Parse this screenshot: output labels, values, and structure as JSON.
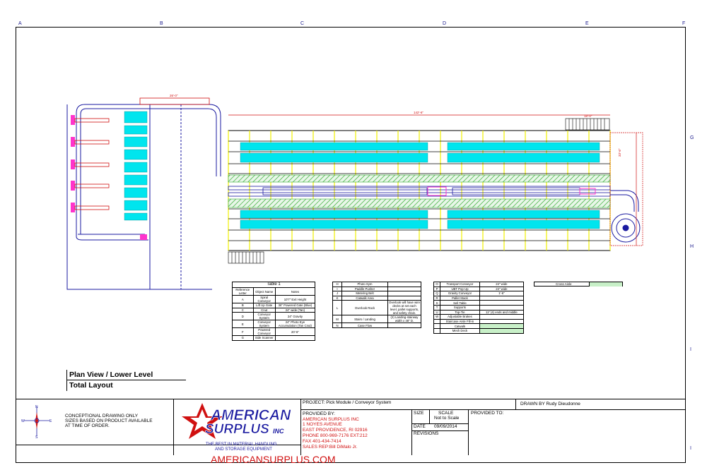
{
  "grid": {
    "top_letters": [
      "A",
      "B",
      "C",
      "D",
      "E",
      "F"
    ],
    "right_letters": [
      "G",
      "H",
      "I",
      "I"
    ]
  },
  "colors": {
    "conveyor_cyan": "#00e5ee",
    "rail_pink": "#ff33cc",
    "dim_red": "#d01010",
    "outline_blue": "#1a1aa0",
    "hatch_green": "#33aa33",
    "post_yellow": "#f0f000"
  },
  "drawing": {
    "dims": {
      "top_width": "26'-0\"",
      "long_width": "142'-6\"",
      "right_box": "18'-0\"",
      "side": "33'-6\""
    }
  },
  "table1": {
    "title": "Table 1",
    "headers": [
      "Reference Letter",
      "Object Name",
      "Notes"
    ],
    "rows": [
      [
        "A",
        "Spiral Conveyor",
        "10'7\" Exit Height"
      ],
      [
        "B",
        "Lift Up Gate",
        "36\" Powered Gate (Blue)"
      ],
      [
        "C",
        "Cnut",
        "24\" wide (Tan)"
      ],
      [
        "D",
        "Conveyor System",
        "24\" Gravity"
      ],
      [
        "E",
        "Conveyor System",
        "24\" Photo Eye Accumulation (Tan Cnut)"
      ],
      [
        "F",
        "Powered Conveyor",
        "20'-6\""
      ],
      [
        "G",
        "Side Scanner",
        ""
      ]
    ]
  },
  "table2": {
    "rows": [
      [
        "H",
        "Photo Sym",
        ""
      ],
      [
        "I",
        "Paddle Pusher",
        ""
      ],
      [
        "J",
        "Metering Belt",
        ""
      ],
      [
        "K",
        "Catwalk Area",
        ""
      ],
      [
        "L",
        "Overlook Rack",
        "Overlook will have wire decks at set each level, pallet supports, and safety chain."
      ],
      [
        "M",
        "Stairs / Landing",
        "(2) Landing-stairway width x 48\" D."
      ],
      [
        "N",
        "Case Flow",
        ""
      ]
    ]
  },
  "table3": {
    "rows": [
      [
        "O",
        "Transport Conveyor",
        "24\" wide"
      ],
      [
        "P",
        "UBT Pop Up",
        "24\" wide"
      ],
      [
        "Q",
        "Gravity Conveyor",
        "1'-6\""
      ],
      [
        "R",
        "Pallet Stack",
        ""
      ],
      [
        "S",
        "Sell Table",
        ""
      ],
      [
        "T",
        "Supports",
        ""
      ],
      [
        "U",
        "Top-Tie",
        "12' (4) ends and middle"
      ],
      [
        "W",
        "Adjustable Brakes",
        ""
      ],
      [
        "",
        "Staircase Aisle Fill-in",
        ""
      ],
      [
        "",
        "Catwalk",
        ""
      ],
      [
        "",
        "Mesh Deck",
        ""
      ]
    ]
  },
  "cross_aisle": "Cross Aisle",
  "view": {
    "line1": "Plan View / Lower Level",
    "line2": "Total Layout"
  },
  "title_block": {
    "note_line1": "CONCEPTIONAL DRAWING ONLY",
    "note_line2": "SIZES BASED ON PRODUCT AVAILABLE",
    "note_line3": "AT TIME OF ORDER.",
    "logo_line1": "AMERICAN",
    "logo_line2": "SURPLUS",
    "logo_inc": "INC",
    "tagline1": "THE BEST IN MATERIAL HANDLING",
    "tagline2": "AND STORAGE EQUIPMENT",
    "project": "PROJECT:  Pick Module / Conveyor System",
    "drawn_by": "DRAWN BY Rudy Dieudonne",
    "provided_by_label": "PROVIDED BY:",
    "provided_by": [
      "AMERICAN SURPLUS INC",
      "1 NOYES AVENUE",
      "EAST PROVIDENCE, RI 02916",
      "PHONE 800-969-7176   EXT:212",
      "FAX 401-434-7414",
      "SALES REP:Bill DiMalo Jr."
    ],
    "size_label": "SIZE",
    "scale_label": "SCALE",
    "scale_value": "Not to Scale",
    "date_label": "DATE",
    "date_value": "09/09/2014",
    "revisions_label": "REVISIONS",
    "provided_to_label": "PROVIDED TO:",
    "compass": {
      "n": "N",
      "s": "S",
      "e": "E",
      "w": "W"
    }
  },
  "footer_url": "AMERICANSURPLUS.COM"
}
